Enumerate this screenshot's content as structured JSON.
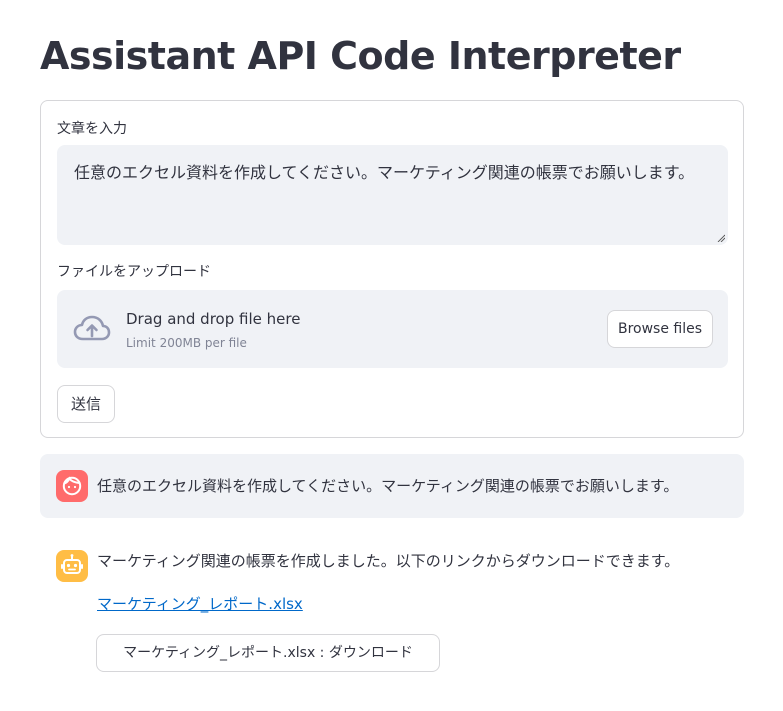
{
  "header": {
    "title": "Assistant API Code Interpreter"
  },
  "form": {
    "text_label": "文章を入力",
    "text_value": "任意のエクセル資料を作成してください。マーケティング関連の帳票でお願いします。",
    "file_label": "ファイルをアップロード",
    "dropzone": {
      "main_text": "Drag and drop file here",
      "sub_text": "Limit 200MB per file",
      "browse_label": "Browse files"
    },
    "submit_label": "送信"
  },
  "chat": {
    "user_message": "任意のエクセル資料を作成してください。マーケティング関連の帳票でお願いします。",
    "assistant_message": "マーケティング関連の帳票を作成しました。以下のリンクからダウンロードできます。",
    "file_link": "マーケティング_レポート.xlsx",
    "download_label": "マーケティング_レポート.xlsx : ダウンロード"
  },
  "icons": {
    "upload": "cloud-upload-icon",
    "user_avatar": "user-avatar-icon",
    "assistant_avatar": "robot-avatar-icon"
  },
  "colors": {
    "user_avatar": "#ff6b6b",
    "assistant_avatar": "#ffbd45",
    "link": "#0068c9",
    "input_bg": "#f0f2f6"
  }
}
